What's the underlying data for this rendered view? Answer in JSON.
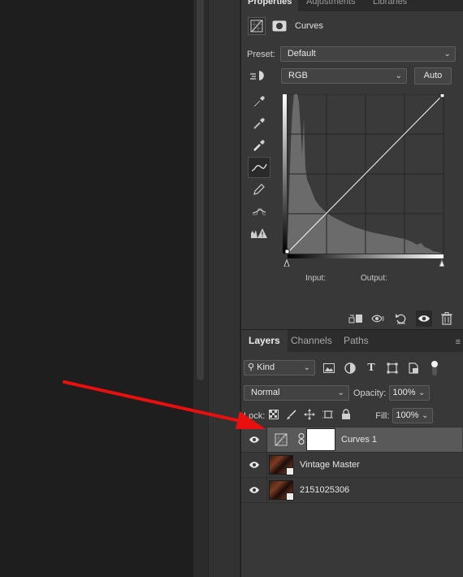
{
  "properties_panel": {
    "tabs": [
      {
        "label": "Properties",
        "active": true
      },
      {
        "label": "Adjustments",
        "active": false
      },
      {
        "label": "Libraries",
        "active": false
      }
    ],
    "header_title": "Curves",
    "preset_label": "Preset:",
    "preset_value": "Default",
    "channel_value": "RGB",
    "auto_label": "Auto",
    "input_label": "Input:",
    "output_label": "Output:",
    "tools": [
      "eyedropper-shadow-icon",
      "eyedropper-midtone-icon",
      "eyedropper-highlight-icon",
      "curve-points-icon",
      "pencil-icon",
      "smooth-icon",
      "clipping-warning-icon"
    ],
    "bottom_icons": [
      "clip-to-layer-icon",
      "view-previous-icon",
      "reset-icon",
      "visibility-eye-icon",
      "trash-icon"
    ]
  },
  "layers_panel": {
    "tabs": [
      {
        "label": "Layers",
        "active": true
      },
      {
        "label": "Channels",
        "active": false
      },
      {
        "label": "Paths",
        "active": false
      }
    ],
    "filter_kind": "Kind",
    "blend_mode": "Normal",
    "opacity_label": "Opacity:",
    "opacity_value": "100%",
    "lock_label": "Lock:",
    "fill_label": "Fill:",
    "fill_value": "100%",
    "layers": [
      {
        "name": "Curves 1",
        "visible": true,
        "selected": true,
        "type": "adjustment"
      },
      {
        "name": "Vintage Master",
        "visible": true,
        "selected": false,
        "type": "smart-object"
      },
      {
        "name": "2151025306",
        "visible": true,
        "selected": false,
        "type": "smart-object"
      }
    ]
  },
  "annotation": {
    "color": "#e8100f",
    "icon": "red-arrow"
  },
  "colors": {
    "panel_bg": "#383838",
    "canvas_bg": "#1e1e1e",
    "histogram": "#6b6b6b",
    "curve_line": "#ffffff"
  }
}
